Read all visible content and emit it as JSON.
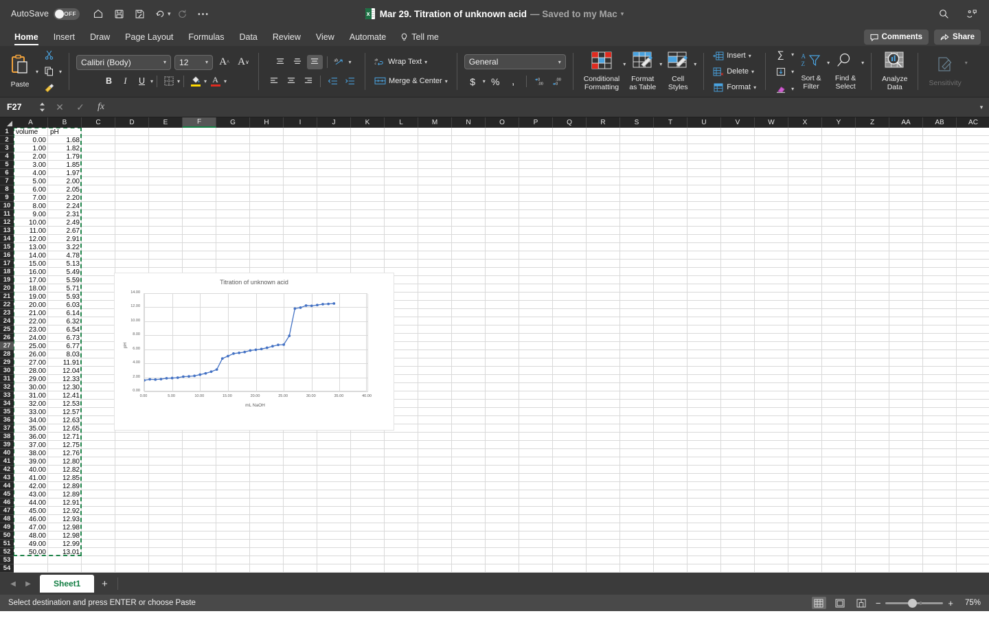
{
  "titlebar": {
    "autosave_label": "AutoSave",
    "autosave_state": "OFF",
    "doc_title": "Mar 29. Titration of unknown acid",
    "saved_status": "— Saved to my Mac",
    "icons": [
      "home-icon",
      "save-icon",
      "save-as-icon",
      "undo-icon",
      "redo-icon",
      "more-icon"
    ],
    "right_icons": [
      "search-icon",
      "accessibility-icon"
    ]
  },
  "ribbon": {
    "tabs": [
      {
        "label": "Home",
        "active": true
      },
      {
        "label": "Insert",
        "active": false
      },
      {
        "label": "Draw",
        "active": false
      },
      {
        "label": "Page Layout",
        "active": false
      },
      {
        "label": "Formulas",
        "active": false
      },
      {
        "label": "Data",
        "active": false
      },
      {
        "label": "Review",
        "active": false
      },
      {
        "label": "View",
        "active": false
      },
      {
        "label": "Automate",
        "active": false
      }
    ],
    "tell_me": "Tell me",
    "comments_label": "Comments",
    "share_label": "Share",
    "paste_label": "Paste",
    "font_name": "Calibri (Body)",
    "font_size": "12",
    "wrap_text": "Wrap Text",
    "merge_center": "Merge & Center",
    "number_format": "General",
    "conditional_formatting": "Conditional\nFormatting",
    "conditional_formatting_l1": "Conditional",
    "conditional_formatting_l2": "Formatting",
    "format_as_table_l1": "Format",
    "format_as_table_l2": "as Table",
    "cell_styles_l1": "Cell",
    "cell_styles_l2": "Styles",
    "insert_label": "Insert",
    "delete_label": "Delete",
    "format_label": "Format",
    "sort_filter_l1": "Sort &",
    "sort_filter_l2": "Filter",
    "find_select_l1": "Find &",
    "find_select_l2": "Select",
    "analyze_data_l1": "Analyze",
    "analyze_data_l2": "Data",
    "sensitivity_label": "Sensitivity"
  },
  "formula_bar": {
    "name_box": "F27",
    "formula_value": "",
    "cancel_icon": "close-icon",
    "confirm_icon": "check-icon",
    "function_icon": "fx-icon"
  },
  "grid": {
    "columns": [
      "A",
      "B",
      "C",
      "D",
      "E",
      "F",
      "G",
      "H",
      "I",
      "J",
      "K",
      "L",
      "M",
      "N",
      "O",
      "P",
      "Q",
      "R",
      "S",
      "T",
      "U",
      "V",
      "W",
      "X",
      "Y",
      "Z",
      "AA",
      "AB",
      "AC"
    ],
    "active_column": "F",
    "active_row": 27,
    "visible_rows": 55,
    "header_row": {
      "A": "volume",
      "B": "pH"
    },
    "data": [
      {
        "row": 2,
        "A": "0.00",
        "B": "1.68"
      },
      {
        "row": 3,
        "A": "1.00",
        "B": "1.82"
      },
      {
        "row": 4,
        "A": "2.00",
        "B": "1.79"
      },
      {
        "row": 5,
        "A": "3.00",
        "B": "1.85"
      },
      {
        "row": 6,
        "A": "4.00",
        "B": "1.97"
      },
      {
        "row": 7,
        "A": "5.00",
        "B": "2.00"
      },
      {
        "row": 8,
        "A": "6.00",
        "B": "2.05"
      },
      {
        "row": 9,
        "A": "7.00",
        "B": "2.20"
      },
      {
        "row": 10,
        "A": "8.00",
        "B": "2.24"
      },
      {
        "row": 11,
        "A": "9.00",
        "B": "2.31"
      },
      {
        "row": 12,
        "A": "10.00",
        "B": "2.49"
      },
      {
        "row": 13,
        "A": "11.00",
        "B": "2.67"
      },
      {
        "row": 14,
        "A": "12.00",
        "B": "2.91"
      },
      {
        "row": 15,
        "A": "13.00",
        "B": "3.22"
      },
      {
        "row": 16,
        "A": "14.00",
        "B": "4.78"
      },
      {
        "row": 17,
        "A": "15.00",
        "B": "5.13"
      },
      {
        "row": 18,
        "A": "16.00",
        "B": "5.49"
      },
      {
        "row": 19,
        "A": "17.00",
        "B": "5.59"
      },
      {
        "row": 20,
        "A": "18.00",
        "B": "5.71"
      },
      {
        "row": 21,
        "A": "19.00",
        "B": "5.93"
      },
      {
        "row": 22,
        "A": "20.00",
        "B": "6.03"
      },
      {
        "row": 23,
        "A": "21.00",
        "B": "6.14"
      },
      {
        "row": 24,
        "A": "22.00",
        "B": "6.32"
      },
      {
        "row": 25,
        "A": "23.00",
        "B": "6.54"
      },
      {
        "row": 26,
        "A": "24.00",
        "B": "6.73"
      },
      {
        "row": 27,
        "A": "25.00",
        "B": "6.77"
      },
      {
        "row": 28,
        "A": "26.00",
        "B": "8.03"
      },
      {
        "row": 29,
        "A": "27.00",
        "B": "11.91"
      },
      {
        "row": 30,
        "A": "28.00",
        "B": "12.04"
      },
      {
        "row": 31,
        "A": "29.00",
        "B": "12.33"
      },
      {
        "row": 32,
        "A": "30.00",
        "B": "12.30"
      },
      {
        "row": 33,
        "A": "31.00",
        "B": "12.41"
      },
      {
        "row": 34,
        "A": "32.00",
        "B": "12.53"
      },
      {
        "row": 35,
        "A": "33.00",
        "B": "12.57"
      },
      {
        "row": 36,
        "A": "34.00",
        "B": "12.63"
      },
      {
        "row": 37,
        "A": "35.00",
        "B": "12.65"
      },
      {
        "row": 38,
        "A": "36.00",
        "B": "12.71"
      },
      {
        "row": 39,
        "A": "37.00",
        "B": "12.75"
      },
      {
        "row": 40,
        "A": "38.00",
        "B": "12.76"
      },
      {
        "row": 41,
        "A": "39.00",
        "B": "12.80"
      },
      {
        "row": 42,
        "A": "40.00",
        "B": "12.82"
      },
      {
        "row": 43,
        "A": "41.00",
        "B": "12.85"
      },
      {
        "row": 44,
        "A": "42.00",
        "B": "12.89"
      },
      {
        "row": 45,
        "A": "43.00",
        "B": "12.89"
      },
      {
        "row": 46,
        "A": "44.00",
        "B": "12.91"
      },
      {
        "row": 47,
        "A": "45.00",
        "B": "12.92"
      },
      {
        "row": 48,
        "A": "46.00",
        "B": "12.93"
      },
      {
        "row": 49,
        "A": "47.00",
        "B": "12.98"
      },
      {
        "row": 50,
        "A": "48.00",
        "B": "12.98"
      },
      {
        "row": 51,
        "A": "49.00",
        "B": "12.99"
      },
      {
        "row": 52,
        "A": "50.00",
        "B": "13.01"
      }
    ]
  },
  "chart_data": {
    "type": "scatter",
    "title": "Titration of unknown acid",
    "xlabel": "mL NaOH",
    "ylabel": "pH",
    "xlim": [
      0,
      40
    ],
    "ylim": [
      0,
      14
    ],
    "xticks": [
      "0.00",
      "5.00",
      "10.00",
      "15.00",
      "20.00",
      "25.00",
      "30.00",
      "35.00",
      "40.00"
    ],
    "yticks": [
      "0.00",
      "2.00",
      "4.00",
      "6.00",
      "8.00",
      "10.00",
      "12.00",
      "14.00"
    ],
    "grid": true,
    "legend": false,
    "series_color": "#4472c4",
    "x": [
      0,
      1,
      2,
      3,
      4,
      5,
      6,
      7,
      8,
      9,
      10,
      11,
      12,
      13,
      14,
      15,
      16,
      17,
      18,
      19,
      20,
      21,
      22,
      23,
      24,
      25,
      26,
      27,
      28,
      29,
      30,
      31,
      32,
      33,
      34
    ],
    "y": [
      1.68,
      1.82,
      1.79,
      1.85,
      1.97,
      2.0,
      2.05,
      2.2,
      2.24,
      2.31,
      2.49,
      2.67,
      2.91,
      3.22,
      4.78,
      5.13,
      5.49,
      5.59,
      5.71,
      5.93,
      6.03,
      6.14,
      6.32,
      6.54,
      6.73,
      6.77,
      8.03,
      11.91,
      12.04,
      12.33,
      12.3,
      12.41,
      12.53,
      12.57,
      12.63
    ]
  },
  "sheet_tabs": {
    "tabs": [
      {
        "label": "Sheet1",
        "active": true
      }
    ],
    "add_label": "+"
  },
  "status_bar": {
    "message": "Select destination and press ENTER or choose Paste",
    "views": [
      "normal-view-icon",
      "page-layout-icon",
      "page-break-icon"
    ],
    "active_view": 0,
    "zoom_out": "−",
    "zoom_in": "+",
    "zoom_level": "75%"
  }
}
